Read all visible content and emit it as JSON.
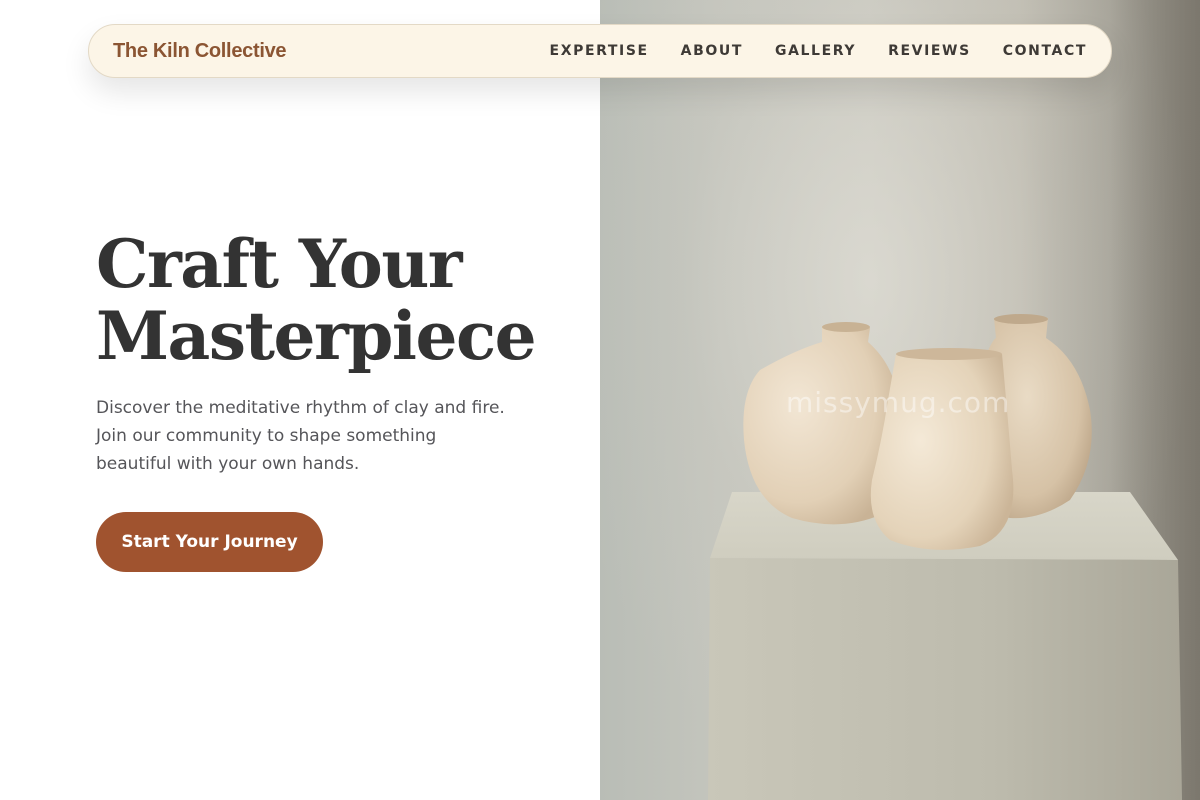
{
  "brand": {
    "name": "The Kiln Collective"
  },
  "nav": {
    "links": [
      {
        "label": "EXPERTISE"
      },
      {
        "label": "ABOUT"
      },
      {
        "label": "GALLERY"
      },
      {
        "label": "REVIEWS"
      },
      {
        "label": "CONTACT"
      }
    ]
  },
  "hero": {
    "title_line1": "Craft Your",
    "title_line2": "Masterpiece",
    "subtitle": "Discover the meditative rhythm of clay and fire. Join our community to shape something beautiful with your own hands.",
    "cta_label": "Start Your Journey"
  },
  "image": {
    "watermark": "missymug.com",
    "subject": "three-ceramic-vases-on-plinth"
  },
  "colors": {
    "accent": "#a0532f",
    "brand_text": "#8b5533",
    "nav_bg": "#fcf5e7",
    "heading": "#333333",
    "body_text": "#555559"
  }
}
